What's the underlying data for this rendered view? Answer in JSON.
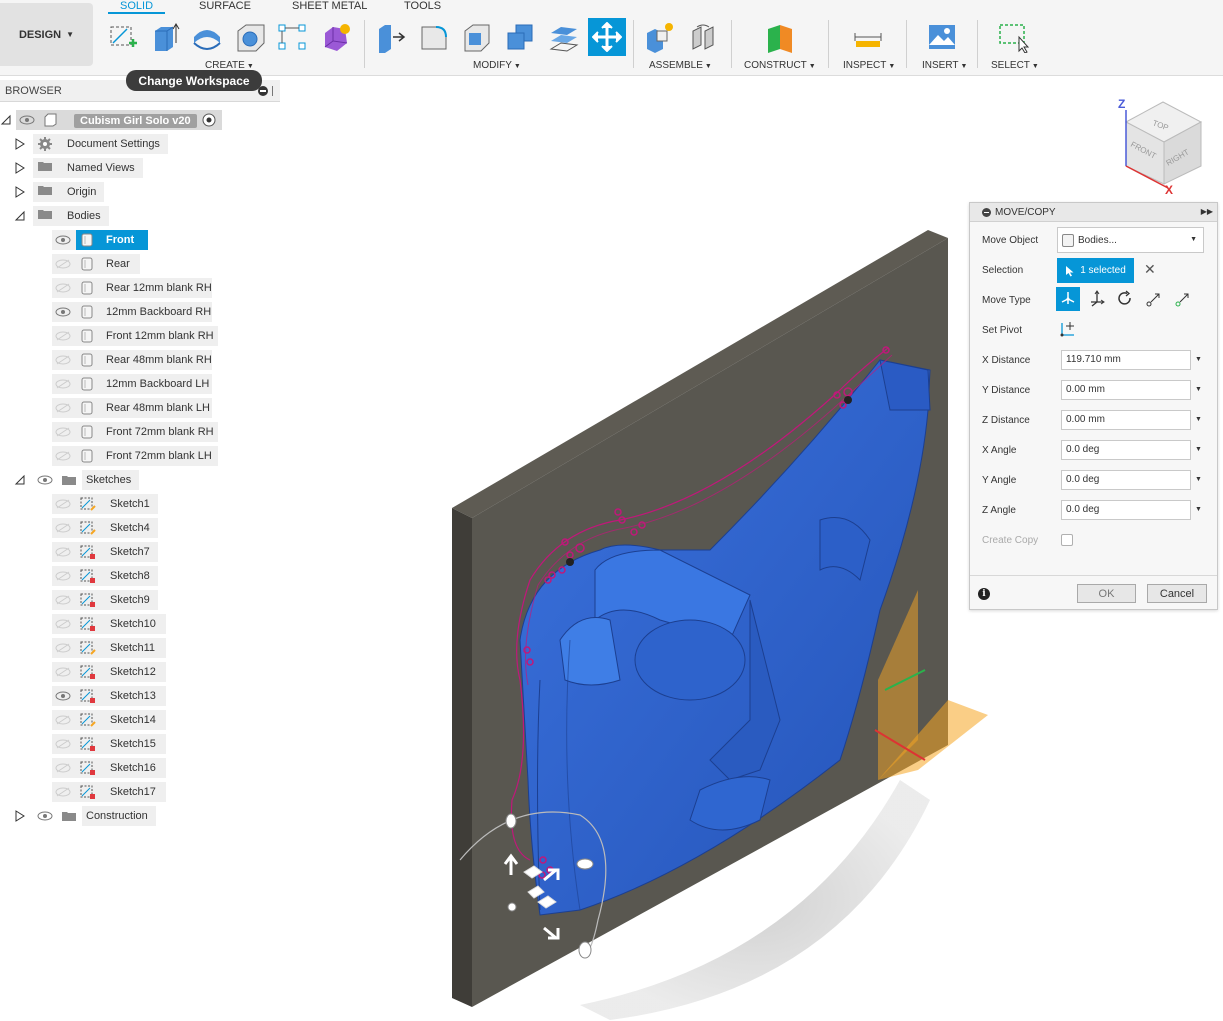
{
  "toolbar": {
    "design_label": "DESIGN",
    "tabs": [
      "SOLID",
      "SURFACE",
      "SHEET METAL",
      "TOOLS"
    ],
    "groups": {
      "create": "CREATE",
      "modify": "MODIFY",
      "assemble": "ASSEMBLE",
      "construct": "CONSTRUCT",
      "inspect": "INSPECT",
      "insert": "INSERT",
      "select": "SELECT"
    },
    "tooltip": "Change Workspace"
  },
  "browser": {
    "title": "BROWSER",
    "root": "Cubism Girl Solo v20",
    "folders": {
      "document_settings": "Document Settings",
      "named_views": "Named Views",
      "origin": "Origin",
      "bodies": "Bodies",
      "sketches": "Sketches",
      "construction": "Construction"
    },
    "bodies": [
      "Front",
      "Rear",
      "Rear 12mm blank RH",
      "12mm Backboard RH",
      "Front 12mm blank RH",
      "Rear 48mm blank RH",
      "12mm Backboard LH",
      "Rear 48mm blank LH",
      "Front  72mm blank RH",
      "Front  72mm blank LH"
    ],
    "sketches": [
      "Sketch1",
      "Sketch4",
      "Sketch7",
      "Sketch8",
      "Sketch9",
      "Sketch10",
      "Sketch11",
      "Sketch12",
      "Sketch13",
      "Sketch14",
      "Sketch15",
      "Sketch16",
      "Sketch17"
    ]
  },
  "viewcube": {
    "top": "TOP",
    "front": "FRONT",
    "right": "RIGHT",
    "z_axis": "Z",
    "x_axis": "X"
  },
  "panel": {
    "title": "MOVE/COPY",
    "move_object_label": "Move Object",
    "move_object_value": "Bodies...",
    "selection_label": "Selection",
    "selection_value": "1 selected",
    "move_type_label": "Move Type",
    "set_pivot_label": "Set Pivot",
    "x_distance_label": "X Distance",
    "x_distance_value": "119.710 mm",
    "y_distance_label": "Y Distance",
    "y_distance_value": "0.00 mm",
    "z_distance_label": "Z Distance",
    "z_distance_value": "0.00 mm",
    "x_angle_label": "X Angle",
    "x_angle_value": "0.0 deg",
    "y_angle_label": "Y Angle",
    "y_angle_value": "0.0 deg",
    "z_angle_label": "Z Angle",
    "z_angle_value": "0.0 deg",
    "create_copy_label": "Create Copy",
    "ok_label": "OK",
    "cancel_label": "Cancel"
  },
  "colors": {
    "accent": "#0696d7",
    "body_blue": "#2f62c9",
    "board": "#5a5750",
    "sketch_magenta": "#c0187a",
    "pivot_orange": "#f5a623"
  }
}
